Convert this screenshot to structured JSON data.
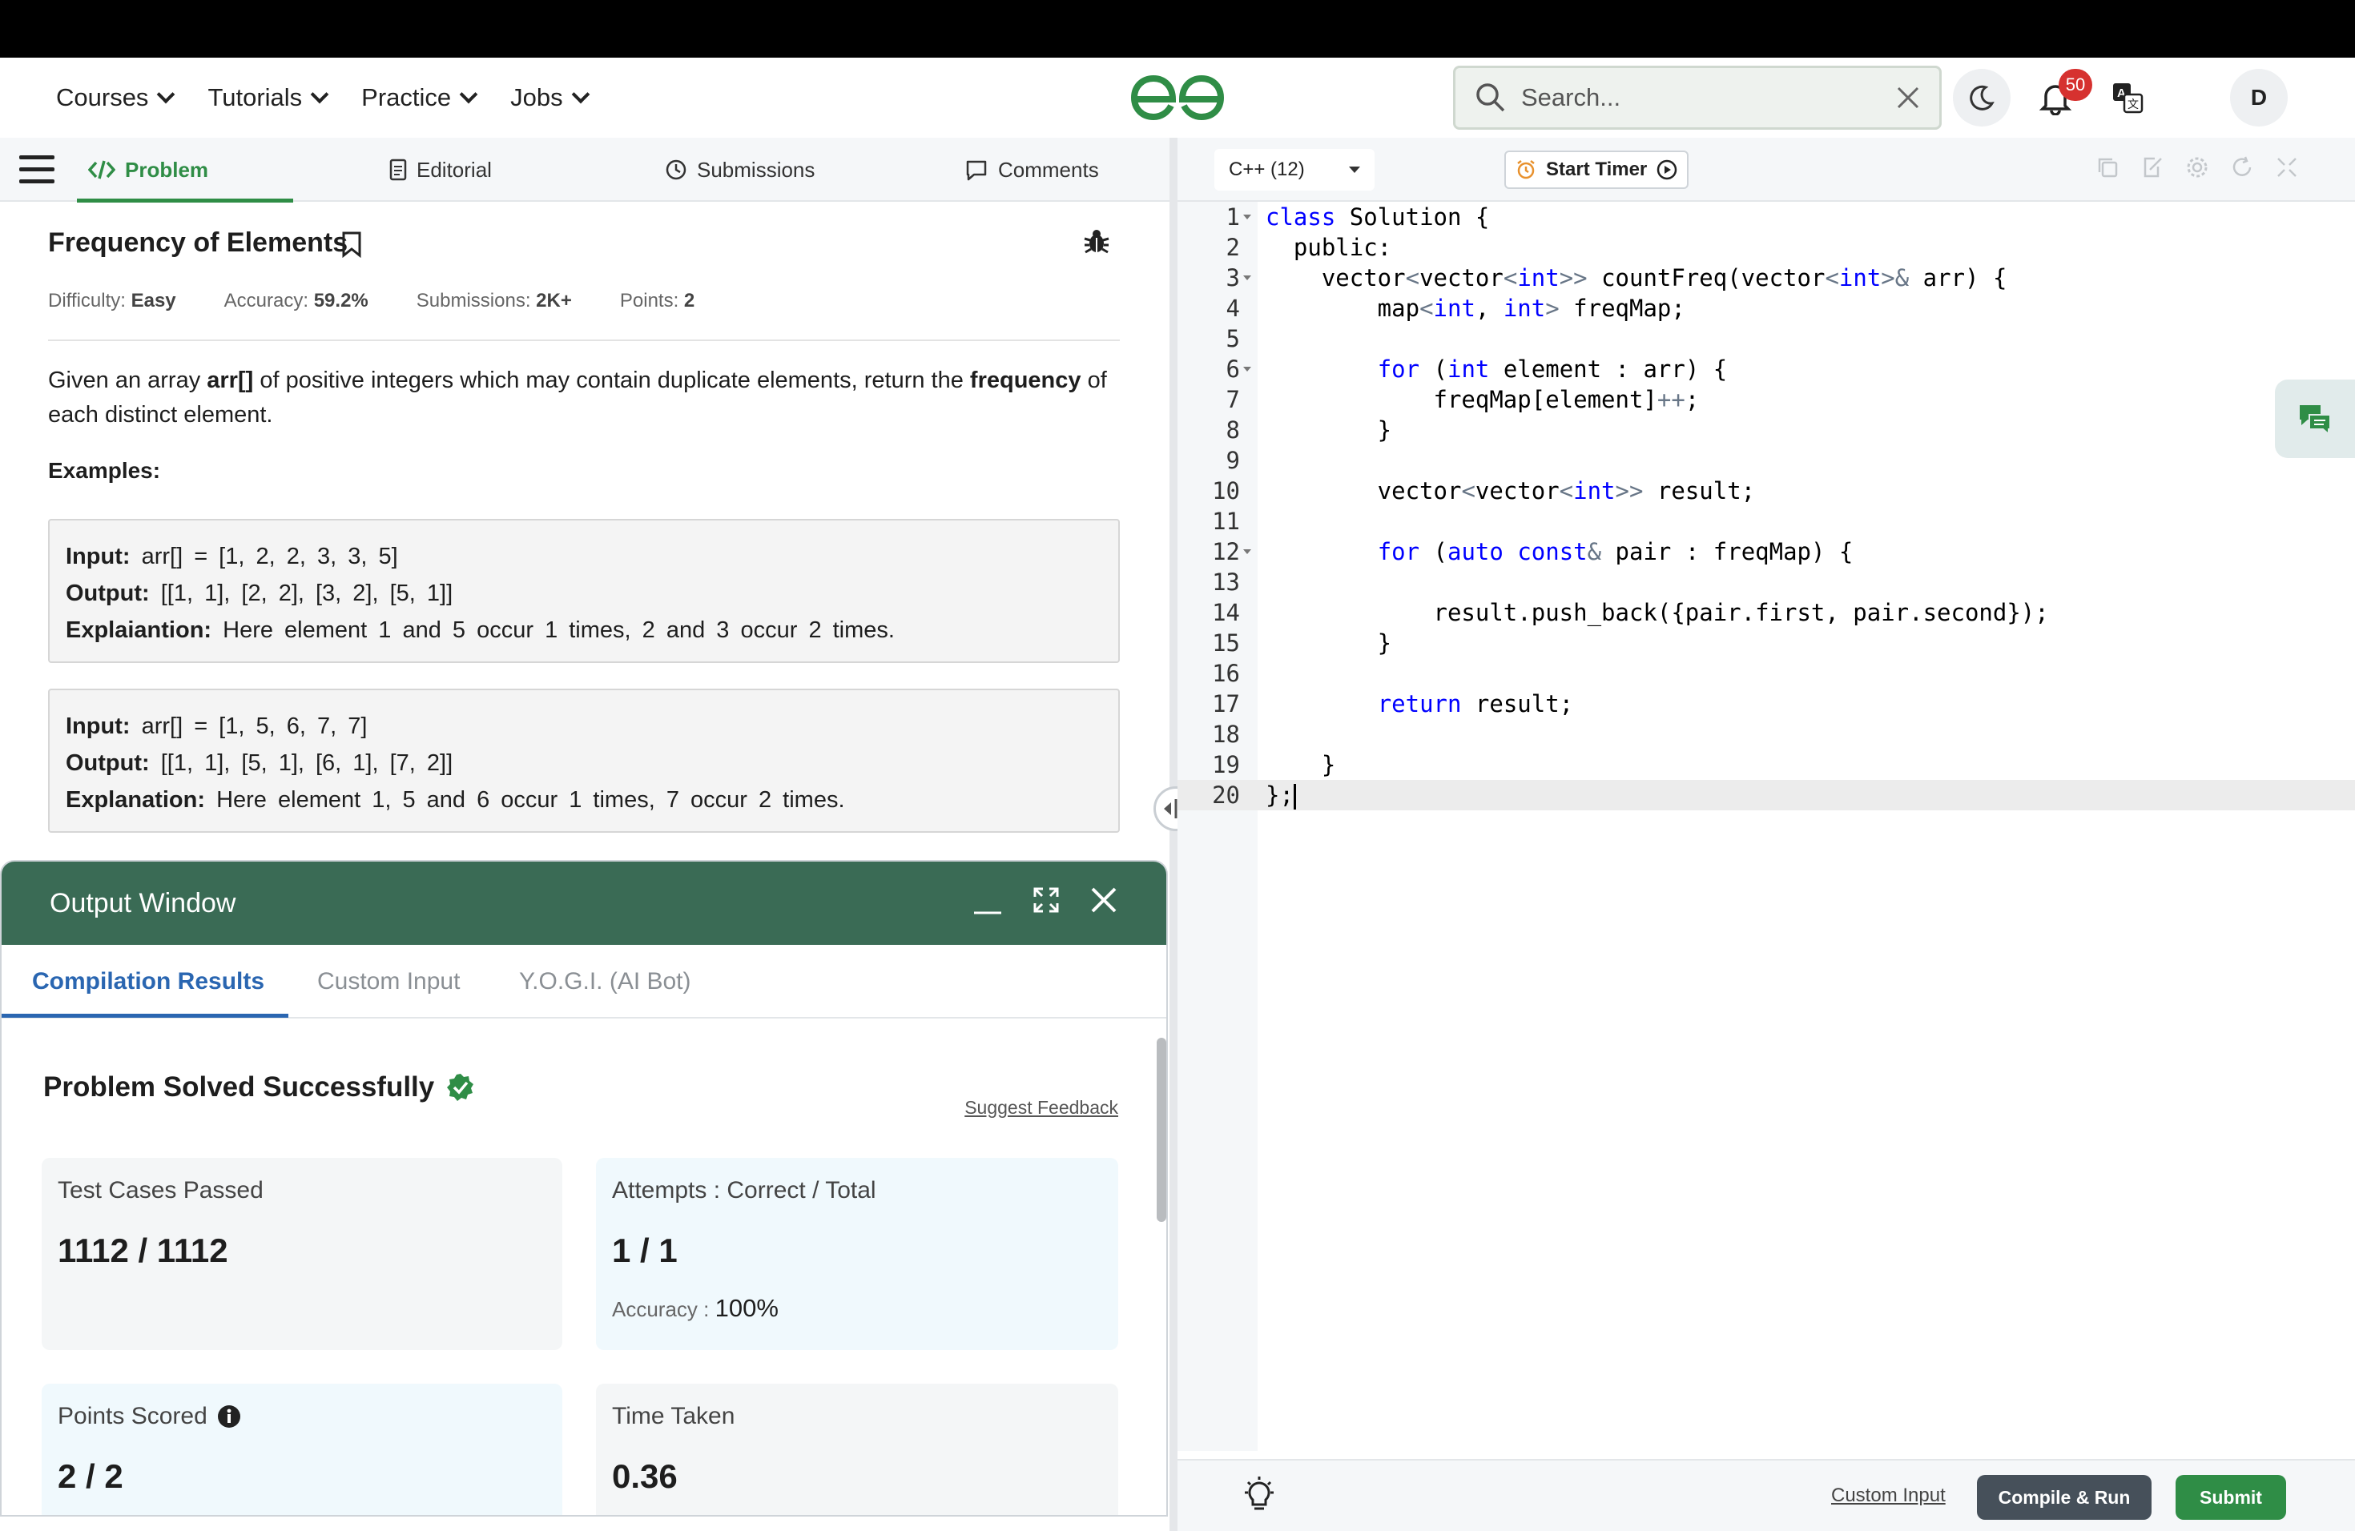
{
  "header": {
    "nav": [
      {
        "label": "Courses"
      },
      {
        "label": "Tutorials"
      },
      {
        "label": "Practice"
      },
      {
        "label": "Jobs"
      }
    ],
    "search_placeholder": "Search...",
    "notification_count": "50",
    "avatar_initial": "D"
  },
  "problem_tabs": {
    "problem": "Problem",
    "editorial": "Editorial",
    "submissions": "Submissions",
    "comments": "Comments"
  },
  "problem": {
    "title": "Frequency of Elements",
    "difficulty_label": "Difficulty:",
    "difficulty": "Easy",
    "accuracy_label": "Accuracy:",
    "accuracy": "59.2%",
    "submissions_label": "Submissions:",
    "submissions": "2K+",
    "points_label": "Points:",
    "points": "2",
    "desc_prefix": "Given an array ",
    "desc_arr": "arr[]",
    "desc_mid": " of positive integers which may contain duplicate elements, return the ",
    "desc_freq": "frequency",
    "desc_suffix": " of each distinct element.",
    "examples_heading": "Examples:",
    "examples": [
      {
        "input_label": "Input:",
        "input": "arr[] = [1, 2, 2, 3, 3, 5]",
        "output_label": "Output:",
        "output": "[[1, 1], [2, 2], [3, 2], [5, 1]]",
        "explain_label": "Explaiantion:",
        "explain": "Here element 1 and 5 occur 1 times, 2 and 3 occur 2 times."
      },
      {
        "input_label": "Input:",
        "input": "arr[] = [1, 5, 6, 7, 7]",
        "output_label": "Output:",
        "output": "[[1, 1], [5, 1], [6, 1], [7, 2]]",
        "explain_label": "Explanation:",
        "explain": "Here element 1, 5 and 6 occur 1 times, 7 occur 2 times."
      }
    ]
  },
  "output_window": {
    "title": "Output Window",
    "tabs": [
      "Compilation Results",
      "Custom Input",
      "Y.O.G.I. (AI Bot)"
    ],
    "status": "Problem Solved Successfully",
    "feedback_link": "Suggest Feedback",
    "cards": {
      "tests_label": "Test Cases Passed",
      "tests_value": "1112 / 1112",
      "attempts_label": "Attempts : Correct / Total",
      "attempts_value": "1 / 1",
      "accuracy_label": "Accuracy :",
      "accuracy_value": "100%",
      "points_label": "Points Scored",
      "points_value": "2 / 2",
      "time_label": "Time Taken",
      "time_value": "0.36"
    }
  },
  "editor": {
    "language": "C++ (12)",
    "timer_label": "Start Timer",
    "code_lines": [
      {
        "n": "1",
        "fold": true
      },
      {
        "n": "2",
        "fold": false
      },
      {
        "n": "3",
        "fold": true
      },
      {
        "n": "4",
        "fold": false
      },
      {
        "n": "5",
        "fold": false
      },
      {
        "n": "6",
        "fold": true
      },
      {
        "n": "7",
        "fold": false
      },
      {
        "n": "8",
        "fold": false
      },
      {
        "n": "9",
        "fold": false
      },
      {
        "n": "10",
        "fold": false
      },
      {
        "n": "11",
        "fold": false
      },
      {
        "n": "12",
        "fold": true
      },
      {
        "n": "13",
        "fold": false
      },
      {
        "n": "14",
        "fold": false
      },
      {
        "n": "15",
        "fold": false
      },
      {
        "n": "16",
        "fold": false
      },
      {
        "n": "17",
        "fold": false
      },
      {
        "n": "18",
        "fold": false
      },
      {
        "n": "19",
        "fold": false
      },
      {
        "n": "20",
        "fold": false
      }
    ],
    "code": {
      "l1_kw": "class",
      "l1_rest": " Solution {",
      "l2": "  public:",
      "l3_a": "    vector",
      "l3_b": "<",
      "l3_c": "vector",
      "l3_d": "<",
      "l3_e": "int",
      "l3_f": ">>",
      "l3_g": " countFreq(vector",
      "l3_h": "<",
      "l3_i": "int",
      "l3_j": ">&",
      "l3_k": " arr) {",
      "l4_a": "        map",
      "l4_b": "<",
      "l4_c": "int",
      "l4_d": ", ",
      "l4_e": "int",
      "l4_f": ">",
      "l4_g": " freqMap;",
      "l6_a": "        ",
      "l6_b": "for",
      "l6_c": " (",
      "l6_d": "int",
      "l6_e": " element : arr) {",
      "l7_a": "            freqMap[element]",
      "l7_b": "++",
      "l7_c": ";",
      "l8": "        }",
      "l10_a": "        vector",
      "l10_b": "<",
      "l10_c": "vector",
      "l10_d": "<",
      "l10_e": "int",
      "l10_f": ">>",
      "l10_g": " result;",
      "l12_a": "        ",
      "l12_b": "for",
      "l12_c": " (",
      "l12_d": "auto",
      "l12_e": " ",
      "l12_f": "const",
      "l12_g": "&",
      "l12_h": " pair : freqMap) {",
      "l14": "            result.push_back({pair.first, pair.second});",
      "l15": "        }",
      "l17_a": "        ",
      "l17_b": "return",
      "l17_c": " result;",
      "l19": "    }",
      "l20": "};"
    },
    "footer": {
      "custom_input": "Custom Input",
      "compile_run": "Compile & Run",
      "submit": "Submit"
    }
  },
  "colors": {
    "brand_green": "#2f8d46",
    "output_header": "#3a6b55",
    "keyword_blue": "#0000ff",
    "badge_red": "#d6312f",
    "tab_blue": "#2a66b1"
  }
}
